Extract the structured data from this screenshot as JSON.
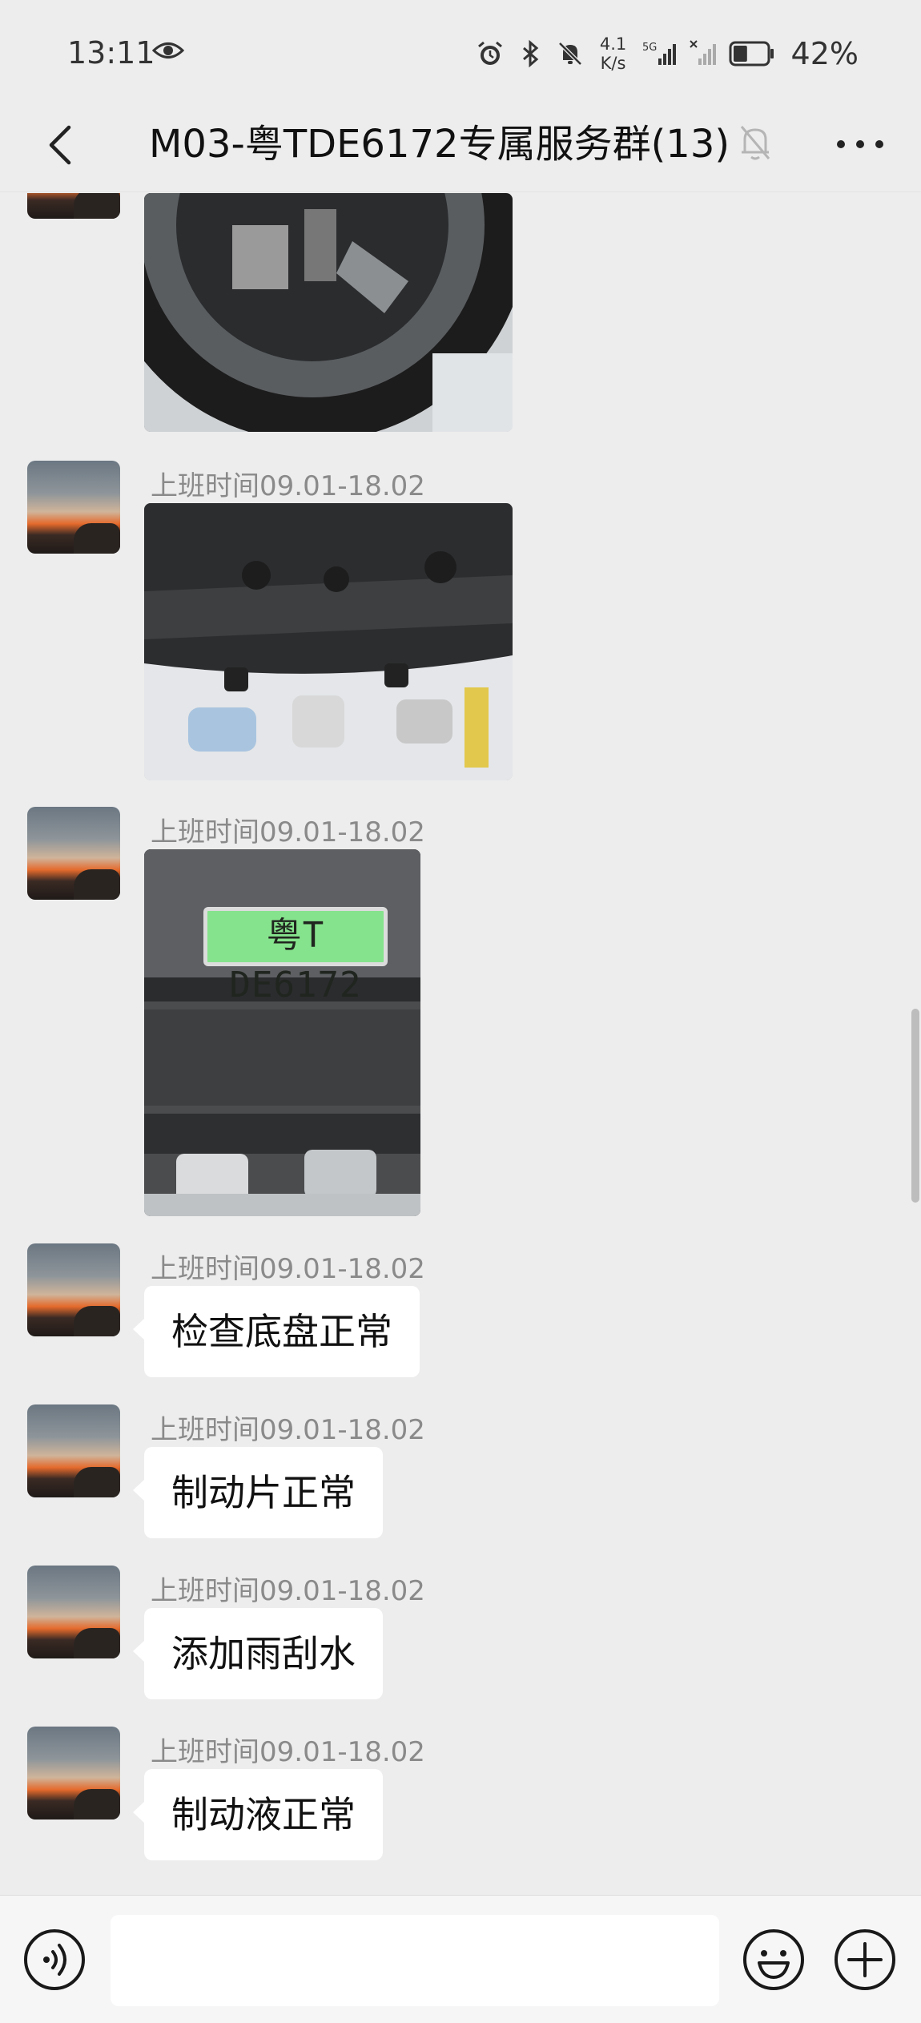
{
  "status_bar": {
    "time": "13:11",
    "net_speed_value": "4.1",
    "net_speed_unit": "K/s",
    "network_type": "5G",
    "battery_percent": "42%",
    "battery_level": 0.42
  },
  "header": {
    "title": "M03-粤TDE6172专属服务群(13)"
  },
  "messages": [
    {
      "type": "image",
      "subject": "tire"
    },
    {
      "type": "image",
      "sender": "上班时间09.01-18.02",
      "subject": "underbody"
    },
    {
      "type": "image",
      "sender": "上班时间09.01-18.02",
      "subject": "license-plate",
      "plate_text": "粤T DE6172"
    },
    {
      "type": "text",
      "sender": "上班时间09.01-18.02",
      "text": "检查底盘正常"
    },
    {
      "type": "text",
      "sender": "上班时间09.01-18.02",
      "text": "制动片正常"
    },
    {
      "type": "text",
      "sender": "上班时间09.01-18.02",
      "text": "添加雨刮水"
    },
    {
      "type": "text",
      "sender": "上班时间09.01-18.02",
      "text": "制动液正常"
    }
  ],
  "input_bar": {
    "message_value": "",
    "icons": [
      "voice-icon",
      "emoji-icon",
      "plus-icon"
    ]
  },
  "colors": {
    "background": "#ededed",
    "bubble": "#ffffff",
    "sender_text": "#8a8a8a",
    "plate_green": "#86e38d"
  }
}
